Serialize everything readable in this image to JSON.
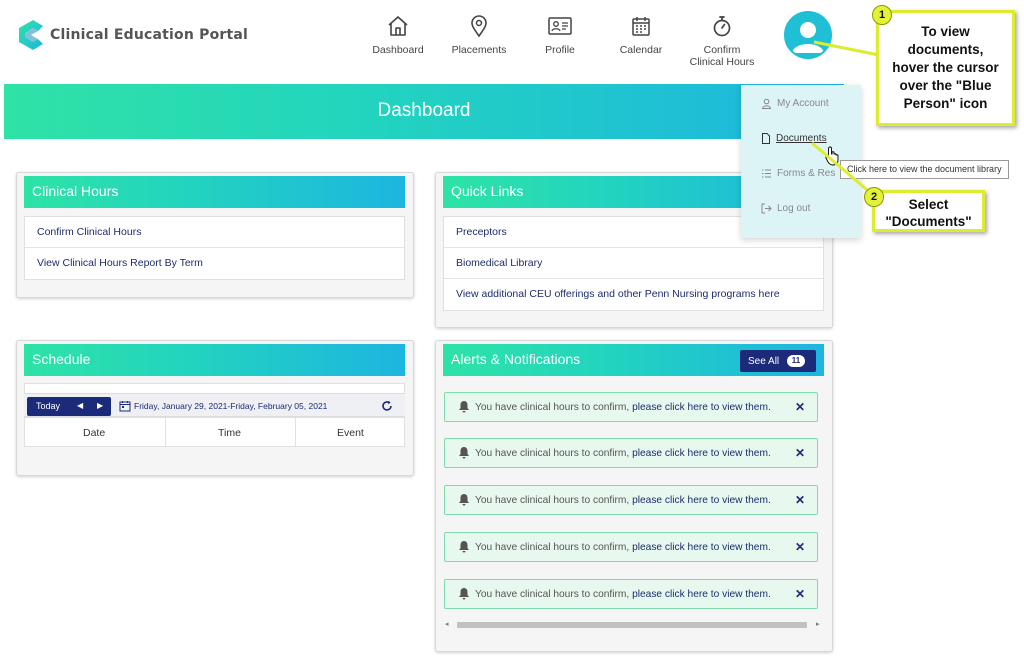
{
  "app": {
    "title": "Clinical Education Portal"
  },
  "nav": [
    {
      "label": "Dashboard",
      "icon": "home-icon"
    },
    {
      "label": "Placements",
      "icon": "location-pin-icon"
    },
    {
      "label": "Profile",
      "icon": "id-card-icon"
    },
    {
      "label": "Calendar",
      "icon": "calendar-icon"
    },
    {
      "label": "Confirm Clinical Hours",
      "line1": "Confirm",
      "line2": "Clinical Hours",
      "icon": "stopwatch-icon"
    }
  ],
  "banner": {
    "title": "Dashboard"
  },
  "clinical_hours": {
    "title": "Clinical Hours",
    "items": [
      "Confirm Clinical Hours",
      "View Clinical Hours Report By Term"
    ]
  },
  "quick_links": {
    "title": "Quick Links",
    "items": [
      "Preceptors",
      "Biomedical Library",
      "View additional CEU offerings and other Penn Nursing programs here"
    ]
  },
  "schedule": {
    "title": "Schedule",
    "today_label": "Today",
    "date_range": "Friday, January 29, 2021-Friday, February 05, 2021",
    "columns": [
      "Date",
      "Time",
      "Event"
    ]
  },
  "alerts": {
    "title": "Alerts & Notifications",
    "see_all_label": "See All",
    "count": "11",
    "items": [
      {
        "text": "You have clinical hours to confirm,",
        "link": "please click here to view them."
      },
      {
        "text": "You have clinical hours to confirm,",
        "link": "please click here to view them."
      },
      {
        "text": "You have clinical hours to confirm,",
        "link": "please click here to view them."
      },
      {
        "text": "You have clinical hours to confirm,",
        "link": "please click here to view them."
      },
      {
        "text": "You have clinical hours to confirm,",
        "link": "please click here to view them."
      }
    ]
  },
  "account_menu": {
    "items": [
      {
        "label": "My Account",
        "icon": "user-icon"
      },
      {
        "label": "Documents",
        "icon": "document-icon"
      },
      {
        "label": "Forms & Res",
        "icon": "list-icon"
      },
      {
        "label": "Log out",
        "icon": "logout-icon"
      }
    ],
    "tooltip": "Click here to view the document library"
  },
  "callouts": [
    {
      "number": "1",
      "line1": "To view",
      "line2": "documents,",
      "line3": "hover the cursor",
      "line4": "over the \"Blue",
      "line5": "Person\" icon"
    },
    {
      "number": "2",
      "line1": "Select",
      "line2": "\"Documents\""
    }
  ],
  "colors": {
    "accent_green": "#2ee3a6",
    "accent_blue": "#1db5e0",
    "navy": "#1c2a7a",
    "callout_yellow": "#ddec2e"
  }
}
